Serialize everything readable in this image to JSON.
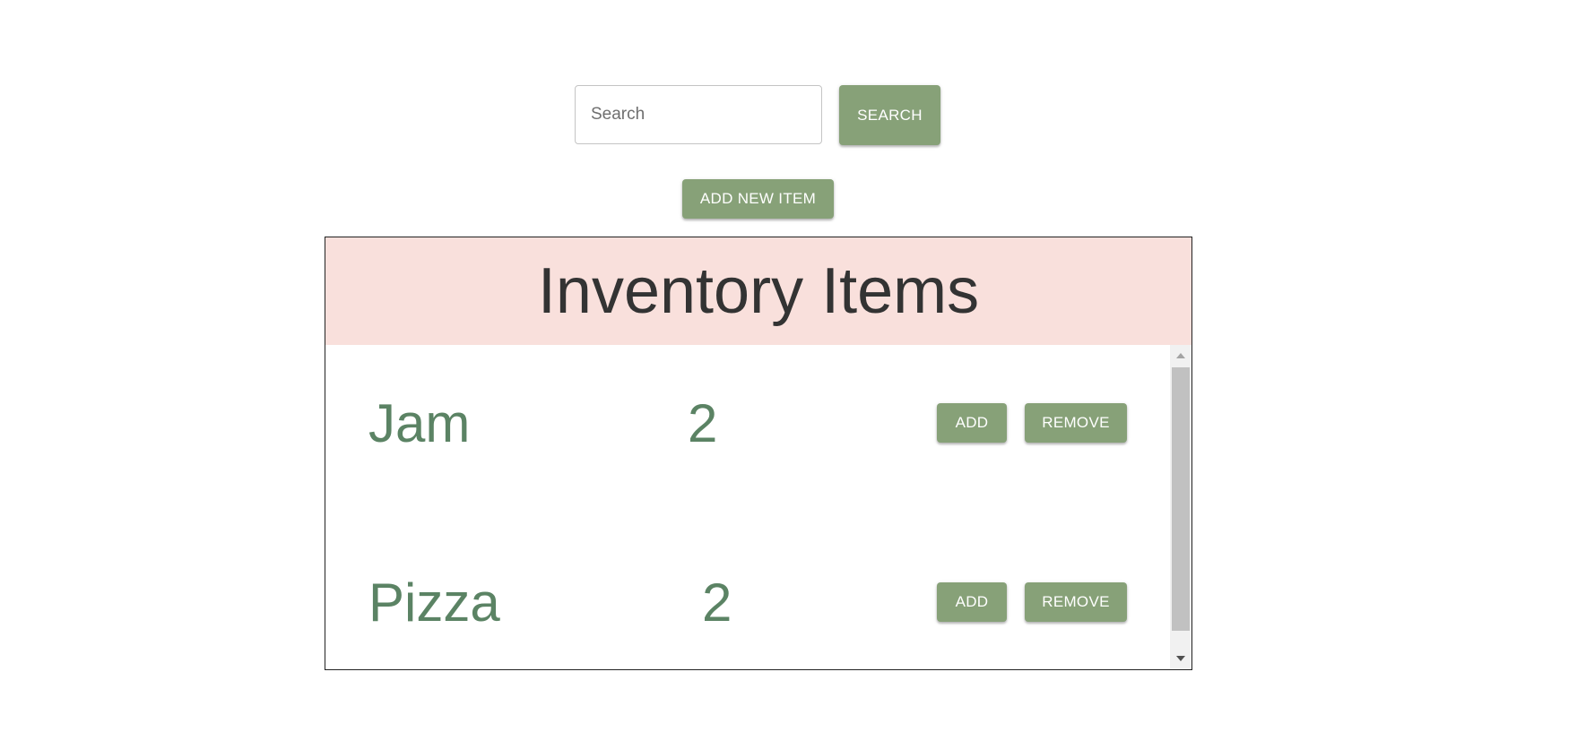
{
  "search": {
    "placeholder": "Search",
    "value": "",
    "button_label": "SEARCH"
  },
  "toolbar": {
    "add_new_label": "ADD NEW ITEM"
  },
  "inventory": {
    "title": "Inventory Items",
    "items": [
      {
        "name": "Jam",
        "quantity": "2",
        "add_label": "ADD",
        "remove_label": "REMOVE"
      },
      {
        "name": "Pizza",
        "quantity": "2",
        "add_label": "ADD",
        "remove_label": "REMOVE"
      }
    ]
  },
  "colors": {
    "accent_button": "#87a178",
    "header_background": "#f9e0dc",
    "item_text": "#5b8364"
  }
}
